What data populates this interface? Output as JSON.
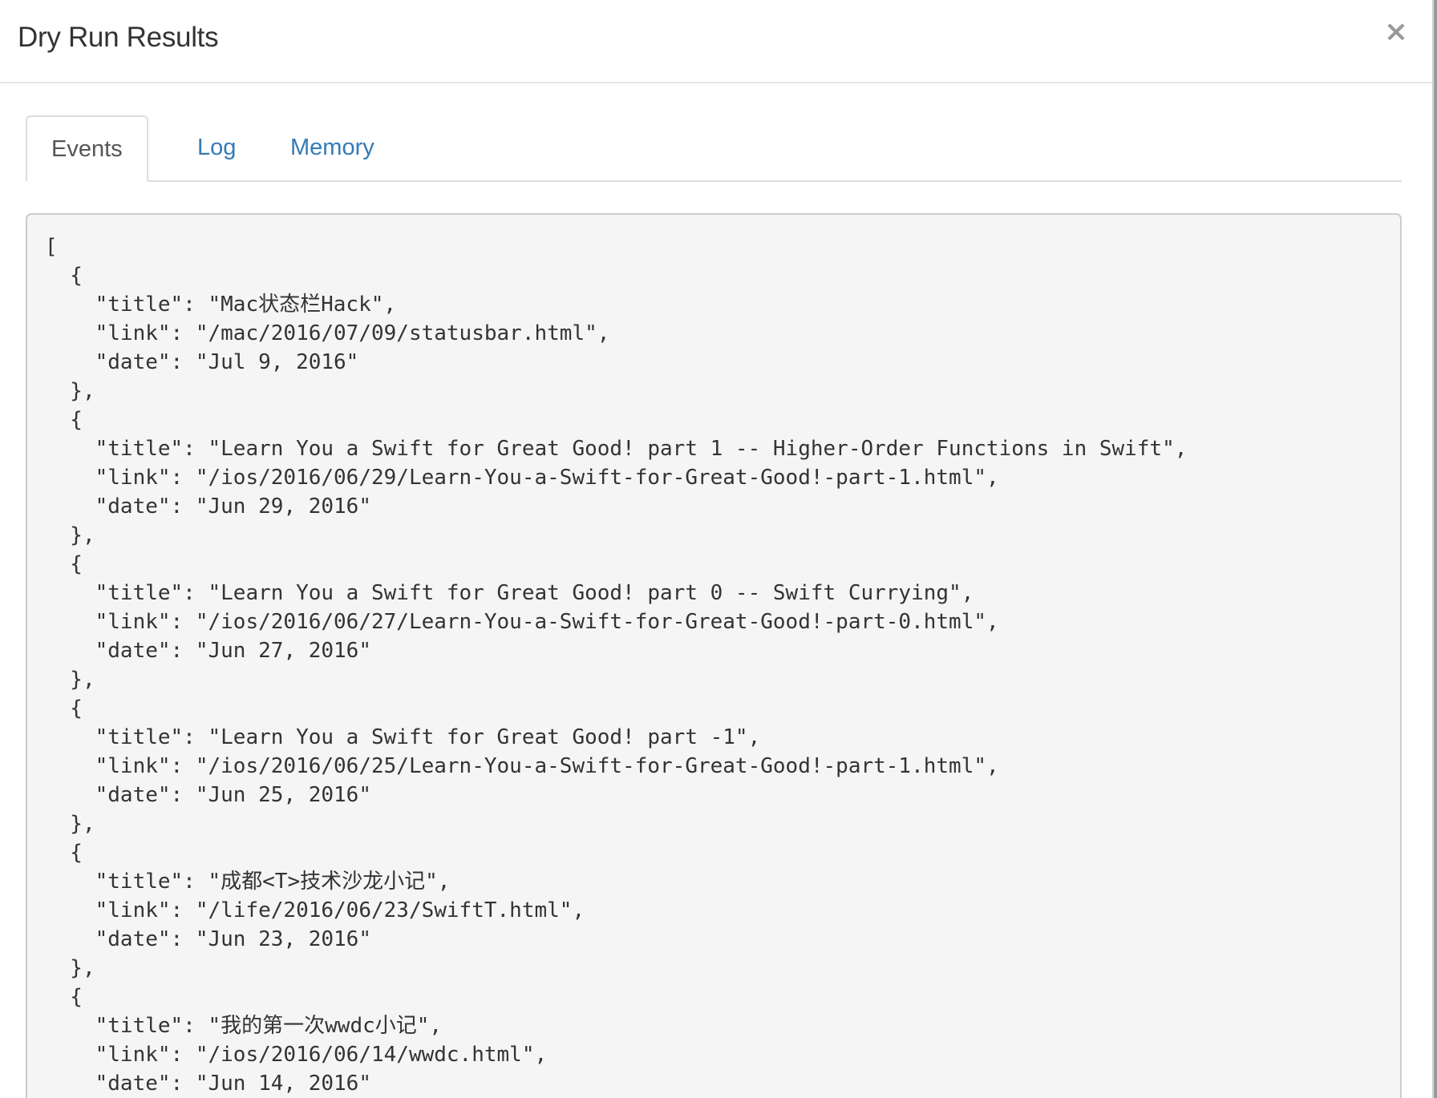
{
  "modal": {
    "title": "Dry Run Results",
    "close_label": "×"
  },
  "tabs": [
    {
      "label": "Events",
      "active": true
    },
    {
      "label": "Log",
      "active": false
    },
    {
      "label": "Memory",
      "active": false
    }
  ],
  "events_output": "[\n  {\n    \"title\": \"Mac状态栏Hack\",\n    \"link\": \"/mac/2016/07/09/statusbar.html\",\n    \"date\": \"Jul 9, 2016\"\n  },\n  {\n    \"title\": \"Learn You a Swift for Great Good! part 1 -- Higher-Order Functions in Swift\",\n    \"link\": \"/ios/2016/06/29/Learn-You-a-Swift-for-Great-Good!-part-1.html\",\n    \"date\": \"Jun 29, 2016\"\n  },\n  {\n    \"title\": \"Learn You a Swift for Great Good! part 0 -- Swift Currying\",\n    \"link\": \"/ios/2016/06/27/Learn-You-a-Swift-for-Great-Good!-part-0.html\",\n    \"date\": \"Jun 27, 2016\"\n  },\n  {\n    \"title\": \"Learn You a Swift for Great Good! part -1\",\n    \"link\": \"/ios/2016/06/25/Learn-You-a-Swift-for-Great-Good!-part-1.html\",\n    \"date\": \"Jun 25, 2016\"\n  },\n  {\n    \"title\": \"成都<T>技术沙龙小记\",\n    \"link\": \"/life/2016/06/23/SwiftT.html\",\n    \"date\": \"Jun 23, 2016\"\n  },\n  {\n    \"title\": \"我的第一次wwdc小记\",\n    \"link\": \"/ios/2016/06/14/wwdc.html\",\n    \"date\": \"Jun 14, 2016\""
}
